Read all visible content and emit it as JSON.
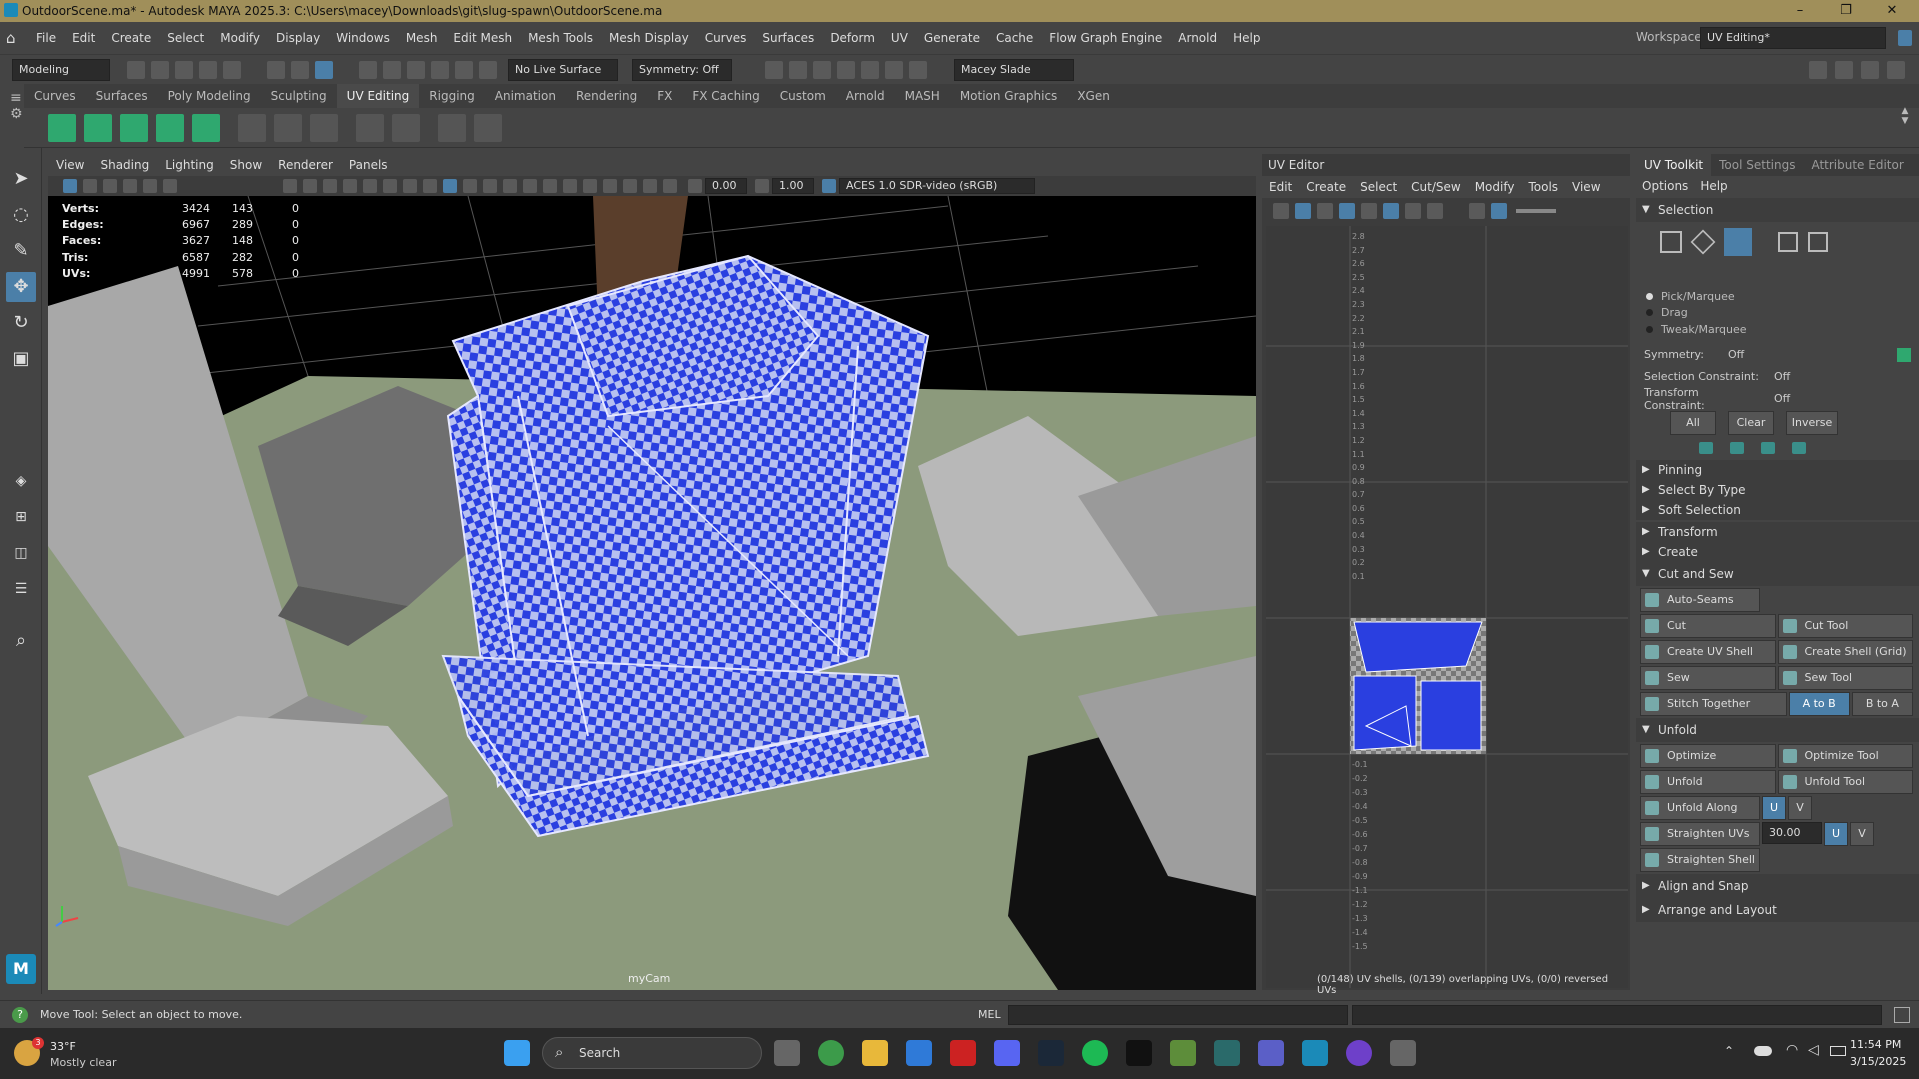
{
  "title": {
    "text": "OutdoorScene.ma* - Autodesk MAYA 2025.3: C:\\Users\\macey\\Downloads\\git\\slug-spawn\\OutdoorScene.ma"
  },
  "window_controls": {
    "minimize": "–",
    "maximize": "❐",
    "close": "✕"
  },
  "menubar": {
    "items": [
      "File",
      "Edit",
      "Create",
      "Select",
      "Modify",
      "Display",
      "Windows",
      "Mesh",
      "Edit Mesh",
      "Mesh Tools",
      "Mesh Display",
      "Curves",
      "Surfaces",
      "Deform",
      "UV",
      "Generate",
      "Cache",
      "Flow Graph Engine",
      "Arnold",
      "Help"
    ],
    "workspace_label": "Workspace:",
    "workspace_value": "UV Editing*"
  },
  "statusline": {
    "mode": "Modeling",
    "live_surface": "No Live Surface",
    "symmetry": "Symmetry: Off",
    "user": "Macey Slade"
  },
  "shelf_tabs": [
    "Curves",
    "Surfaces",
    "Poly Modeling",
    "Sculpting",
    "UV Editing",
    "Rigging",
    "Animation",
    "Rendering",
    "FX",
    "FX Caching",
    "Custom",
    "Arnold",
    "MASH",
    "Motion Graphics",
    "XGen"
  ],
  "shelf_active": "UV Editing",
  "viewport": {
    "menu": [
      "View",
      "Shading",
      "Lighting",
      "Show",
      "Renderer",
      "Panels"
    ],
    "field1": "0.00",
    "field2": "1.00",
    "colorspace": "ACES 1.0 SDR-video (sRGB)",
    "camera": "myCam",
    "hud": [
      {
        "label": "Verts:",
        "a": "3424",
        "b": "143",
        "c": "0"
      },
      {
        "label": "Edges:",
        "a": "6967",
        "b": "289",
        "c": "0"
      },
      {
        "label": "Faces:",
        "a": "3627",
        "b": "148",
        "c": "0"
      },
      {
        "label": "Tris:",
        "a": "6587",
        "b": "282",
        "c": "0"
      },
      {
        "label": "UVs:",
        "a": "4991",
        "b": "578",
        "c": "0"
      }
    ]
  },
  "uv_editor": {
    "title": "UV Editor",
    "menu": [
      "Edit",
      "Create",
      "Select",
      "Cut/Sew",
      "Modify",
      "Tools",
      "View"
    ],
    "status": "(0/148) UV shells, (0/139) overlapping UVs, (0/0) reversed UVs",
    "v_ticks_top": [
      "2.8",
      "2.7",
      "2.6",
      "2.5",
      "2.4",
      "2.3",
      "2.2",
      "2.1",
      "1.9",
      "1.8",
      "1.7",
      "1.6",
      "1.5",
      "1.4",
      "1.3",
      "1.2",
      "1.1",
      "0.9",
      "0.8",
      "0.7",
      "0.6",
      "0.5",
      "0.4",
      "0.3",
      "0.2",
      "0.1"
    ],
    "v_ticks_bottom": [
      "-0.1",
      "-0.2",
      "-0.3",
      "-0.4",
      "-0.5",
      "-0.6",
      "-0.7",
      "-0.8",
      "-0.9",
      "-1.1",
      "-1.2",
      "-1.3",
      "-1.4",
      "-1.5"
    ]
  },
  "toolkit": {
    "tabs": [
      "UV Toolkit",
      "Tool Settings",
      "Attribute Editor"
    ],
    "menu": [
      "Options",
      "Help"
    ],
    "selection_title": "Selection",
    "radios": [
      "Pick/Marquee",
      "Drag",
      "Tweak/Marquee"
    ],
    "symmetry_label": "Symmetry:",
    "symmetry_value": "Off",
    "sel_constraint_label": "Selection Constraint:",
    "sel_constraint_value": "Off",
    "xform_constraint_label": "Transform Constraint:",
    "xform_constraint_value": "Off",
    "all": "All",
    "clear": "Clear",
    "inverse": "Inverse",
    "collapsed1": [
      "Pinning",
      "Select By Type",
      "Soft Selection"
    ],
    "collapsed2": [
      "Transform",
      "Create"
    ],
    "cut_sew_title": "Cut and Sew",
    "auto_seams": "Auto-Seams",
    "cut": "Cut",
    "cut_tool": "Cut Tool",
    "create_uv_shell": "Create UV Shell",
    "create_shell_grid": "Create Shell (Grid)",
    "sew": "Sew",
    "sew_tool": "Sew Tool",
    "stitch_together": "Stitch Together",
    "a_to_b": "A to B",
    "b_to_a": "B to A",
    "unfold_title": "Unfold",
    "optimize": "Optimize",
    "optimize_tool": "Optimize Tool",
    "unfold": "Unfold",
    "unfold_tool": "Unfold Tool",
    "unfold_along": "Unfold Along",
    "u": "U",
    "v": "V",
    "straighten_uvs": "Straighten UVs",
    "straighten_value": "30.00",
    "straighten_shell": "Straighten Shell",
    "align_snap": "Align and Snap",
    "arrange_layout": "Arrange and Layout"
  },
  "helpline": {
    "text": "Move Tool: Select an object to move.",
    "mel": "MEL"
  },
  "taskbar": {
    "weather_temp": "33°F",
    "weather_desc": "Mostly clear",
    "weather_badge": "3",
    "search": "Search",
    "time": "11:54 PM",
    "date": "3/15/2025"
  },
  "colors": {
    "accent": "#4b7fa8",
    "title_bar": "#a08f5a",
    "checker_blue": "#2a3fe0"
  }
}
